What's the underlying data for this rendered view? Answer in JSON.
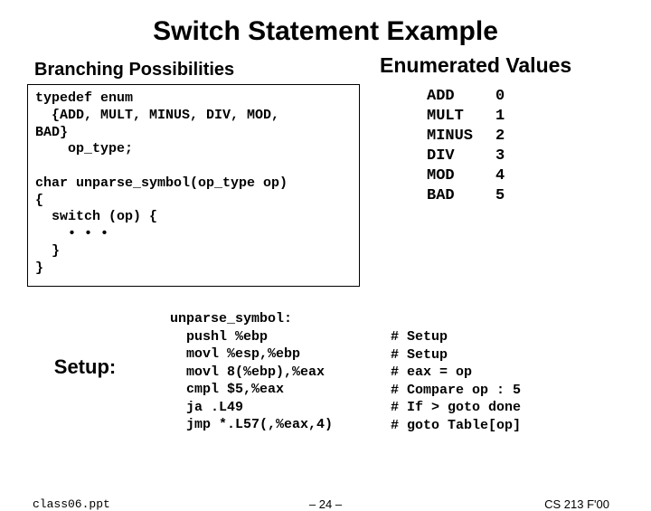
{
  "title": "Switch Statement Example",
  "subhead": "Branching Possibilities",
  "code_block": "typedef enum\n  {ADD, MULT, MINUS, DIV, MOD,\nBAD}\n    op_type;\n\nchar unparse_symbol(op_type op)\n{\n  switch (op) {\n    • • •\n  }\n}",
  "enum_title": "Enumerated Values",
  "enum_rows": [
    {
      "name": "ADD",
      "val": "0"
    },
    {
      "name": "MULT",
      "val": "1"
    },
    {
      "name": "MINUS",
      "val": "2"
    },
    {
      "name": "DIV",
      "val": "3"
    },
    {
      "name": "MOD",
      "val": "4"
    },
    {
      "name": "BAD",
      "val": "5"
    }
  ],
  "setup_label": "Setup:",
  "asm_code": "unparse_symbol:\n  pushl %ebp\n  movl %esp,%ebp\n  movl 8(%ebp),%eax\n  cmpl $5,%eax\n  ja .L49\n  jmp *.L57(,%eax,4)",
  "asm_comments": "# Setup\n# Setup\n# eax = op\n# Compare op : 5\n# If > goto done\n# goto Table[op]",
  "footer": {
    "left": "class06.ppt",
    "center": "– 24 –",
    "right": "CS 213 F'00"
  }
}
